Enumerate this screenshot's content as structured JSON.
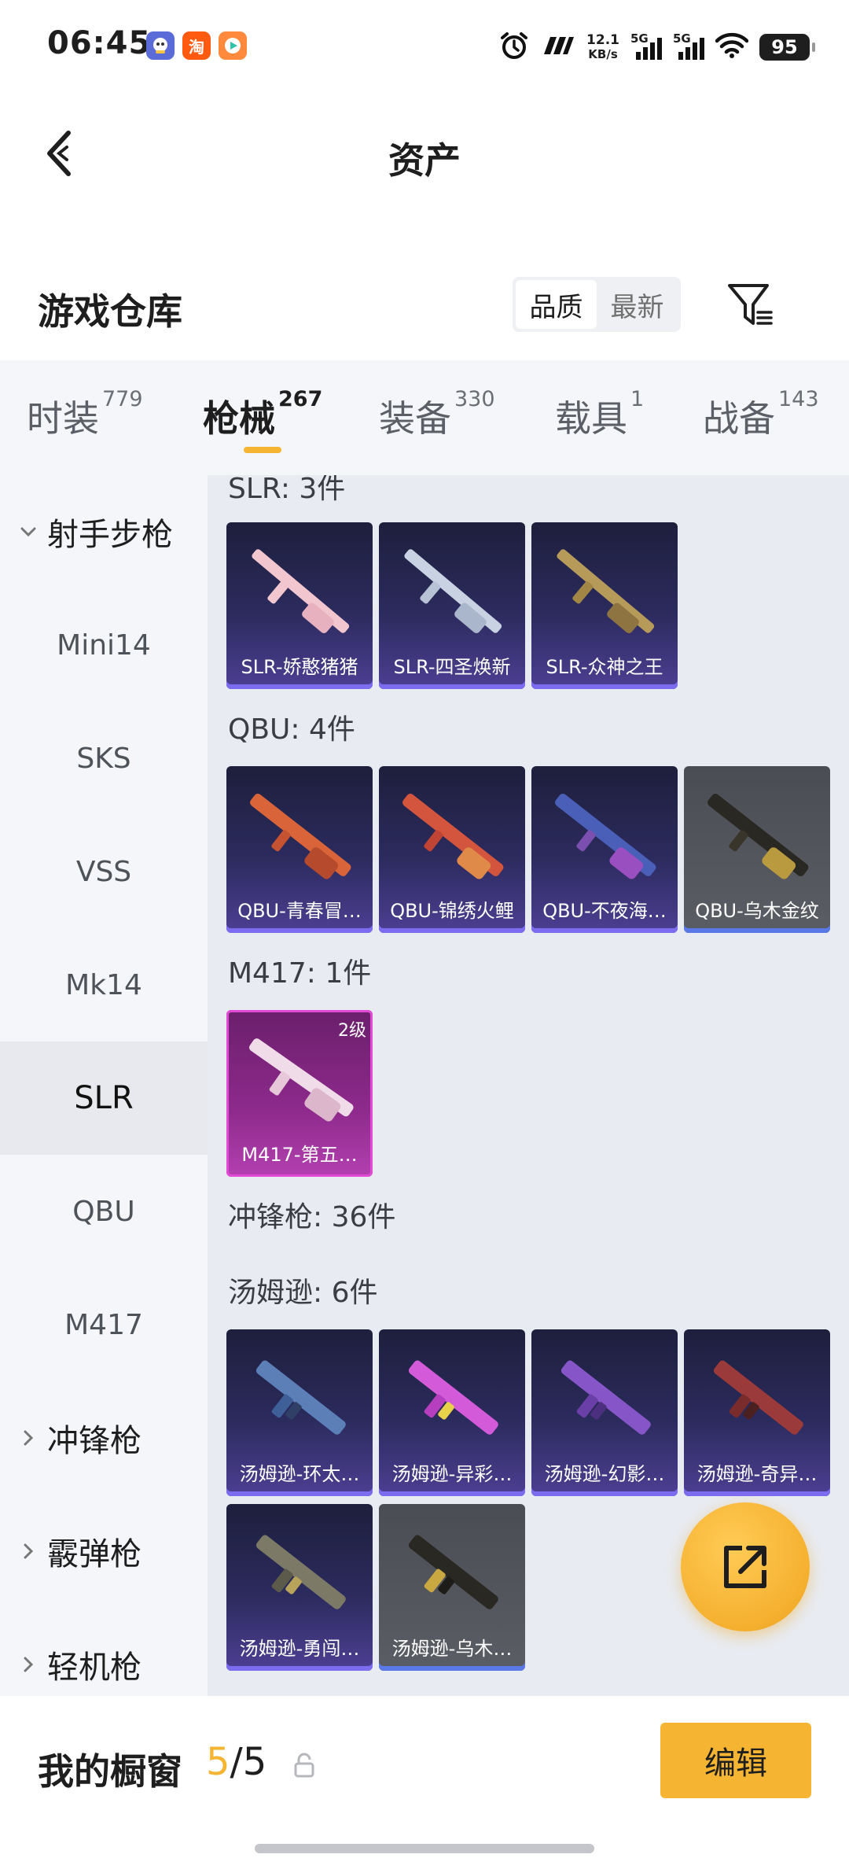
{
  "status_bar": {
    "time": "06:45",
    "app_icons": [
      "mascot-app-icon",
      "taobao-app-icon",
      "video-app-icon"
    ],
    "taobao_label": "淘",
    "net_speed_value": "12.1",
    "net_speed_unit": "KB/s",
    "signal_1": "5G",
    "signal_2": "5G",
    "battery": "95"
  },
  "header": {
    "title": "资产"
  },
  "warehouse": {
    "title": "游戏仓库",
    "sort_options": [
      "品质",
      "最新"
    ],
    "sort_selected": "品质"
  },
  "tabs": [
    {
      "label": "时装",
      "count": "779"
    },
    {
      "label": "枪械",
      "count": "267"
    },
    {
      "label": "装备",
      "count": "330"
    },
    {
      "label": "载具",
      "count": "1"
    },
    {
      "label": "战备",
      "count": "143"
    }
  ],
  "active_tab": "枪械",
  "sidebar": {
    "items": [
      {
        "label": "射手步枪",
        "type": "group",
        "expanded": true
      },
      {
        "label": "Mini14",
        "type": "item"
      },
      {
        "label": "SKS",
        "type": "item"
      },
      {
        "label": "VSS",
        "type": "item"
      },
      {
        "label": "Mk14",
        "type": "item"
      },
      {
        "label": "SLR",
        "type": "item",
        "active": true
      },
      {
        "label": "QBU",
        "type": "item"
      },
      {
        "label": "M417",
        "type": "item"
      },
      {
        "label": "冲锋枪",
        "type": "group",
        "expanded": false
      },
      {
        "label": "霰弹枪",
        "type": "group",
        "expanded": false
      },
      {
        "label": "轻机枪",
        "type": "group",
        "expanded": false
      }
    ]
  },
  "sections": [
    {
      "title": "SLR: 3件",
      "items": [
        {
          "name": "SLR-娇憨猪猪",
          "style": "purple"
        },
        {
          "name": "SLR-四圣焕新",
          "style": "purple"
        },
        {
          "name": "SLR-众神之王",
          "style": "purple"
        }
      ]
    },
    {
      "title": "QBU: 4件",
      "items": [
        {
          "name": "QBU-青春冒…",
          "style": "purple"
        },
        {
          "name": "QBU-锦绣火鲤",
          "style": "purple"
        },
        {
          "name": "QBU-不夜海…",
          "style": "purple"
        },
        {
          "name": "QBU-乌木金纹",
          "style": "grey"
        }
      ]
    },
    {
      "title": "M417: 1件",
      "items": [
        {
          "name": "M417-第五…",
          "style": "pink",
          "level": "2级"
        }
      ]
    },
    {
      "title": "冲锋枪: 36件",
      "items": []
    },
    {
      "title": "汤姆逊: 6件",
      "items": [
        {
          "name": "汤姆逊-环太…",
          "style": "purple"
        },
        {
          "name": "汤姆逊-异彩…",
          "style": "purple"
        },
        {
          "name": "汤姆逊-幻影…",
          "style": "purple"
        },
        {
          "name": "汤姆逊-奇异…",
          "style": "purple"
        },
        {
          "name": "汤姆逊-勇闯…",
          "style": "purple"
        },
        {
          "name": "汤姆逊-乌木…",
          "style": "grey"
        }
      ]
    }
  ],
  "bottom_bar": {
    "label": "我的橱窗",
    "current": "5",
    "separator": "/",
    "total": "5",
    "edit_label": "编辑"
  },
  "colors": {
    "accent": "#f5b532",
    "sidebar_bg": "#f4f6fa",
    "content_bg": "#e8ebf1",
    "card_purple": "#2c2b5e",
    "card_grey": "#55575f",
    "card_pink": "#8e2a8c"
  }
}
